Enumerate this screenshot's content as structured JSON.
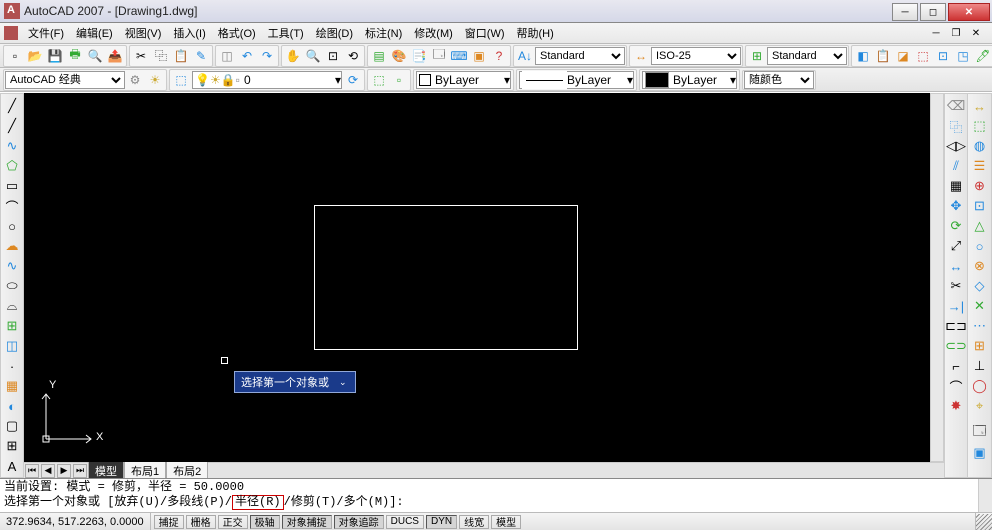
{
  "app": {
    "title": "AutoCAD 2007 - [Drawing1.dwg]"
  },
  "menu": {
    "items": [
      "文件(F)",
      "编辑(E)",
      "视图(V)",
      "插入(I)",
      "格式(O)",
      "工具(T)",
      "绘图(D)",
      "标注(N)",
      "修改(M)",
      "窗口(W)",
      "帮助(H)"
    ]
  },
  "toolbar1": {
    "style1": "Standard",
    "style2": "ISO-25",
    "style3": "Standard"
  },
  "toolbar2": {
    "workspace": "AutoCAD 经典",
    "layer": "0",
    "linetype_label": "ByLayer",
    "lineweight_label": "ByLayer",
    "color_label": "ByLayer",
    "plotcolor": "随颜色"
  },
  "canvas": {
    "tooltip": "选择第一个对象或",
    "ucs_x": "X",
    "ucs_y": "Y"
  },
  "tabs": {
    "items": [
      "模型",
      "布局1",
      "布局2"
    ]
  },
  "command": {
    "line1": "当前设置: 模式 = 修剪，半径 = 50.0000",
    "line2_pre": "选择第一个对象或 [放弃(U)/多段线(P)/",
    "line2_hi": "半径(R)",
    "line2_post": "/修剪(T)/多个(M)]:"
  },
  "status": {
    "coords": "372.9634, 517.2263, 0.0000",
    "toggles": [
      "捕捉",
      "栅格",
      "正交",
      "极轴",
      "对象捕捉",
      "对象追踪",
      "DUCS",
      "DYN",
      "线宽",
      "模型"
    ],
    "pressed": [
      3,
      4,
      5,
      7
    ]
  }
}
